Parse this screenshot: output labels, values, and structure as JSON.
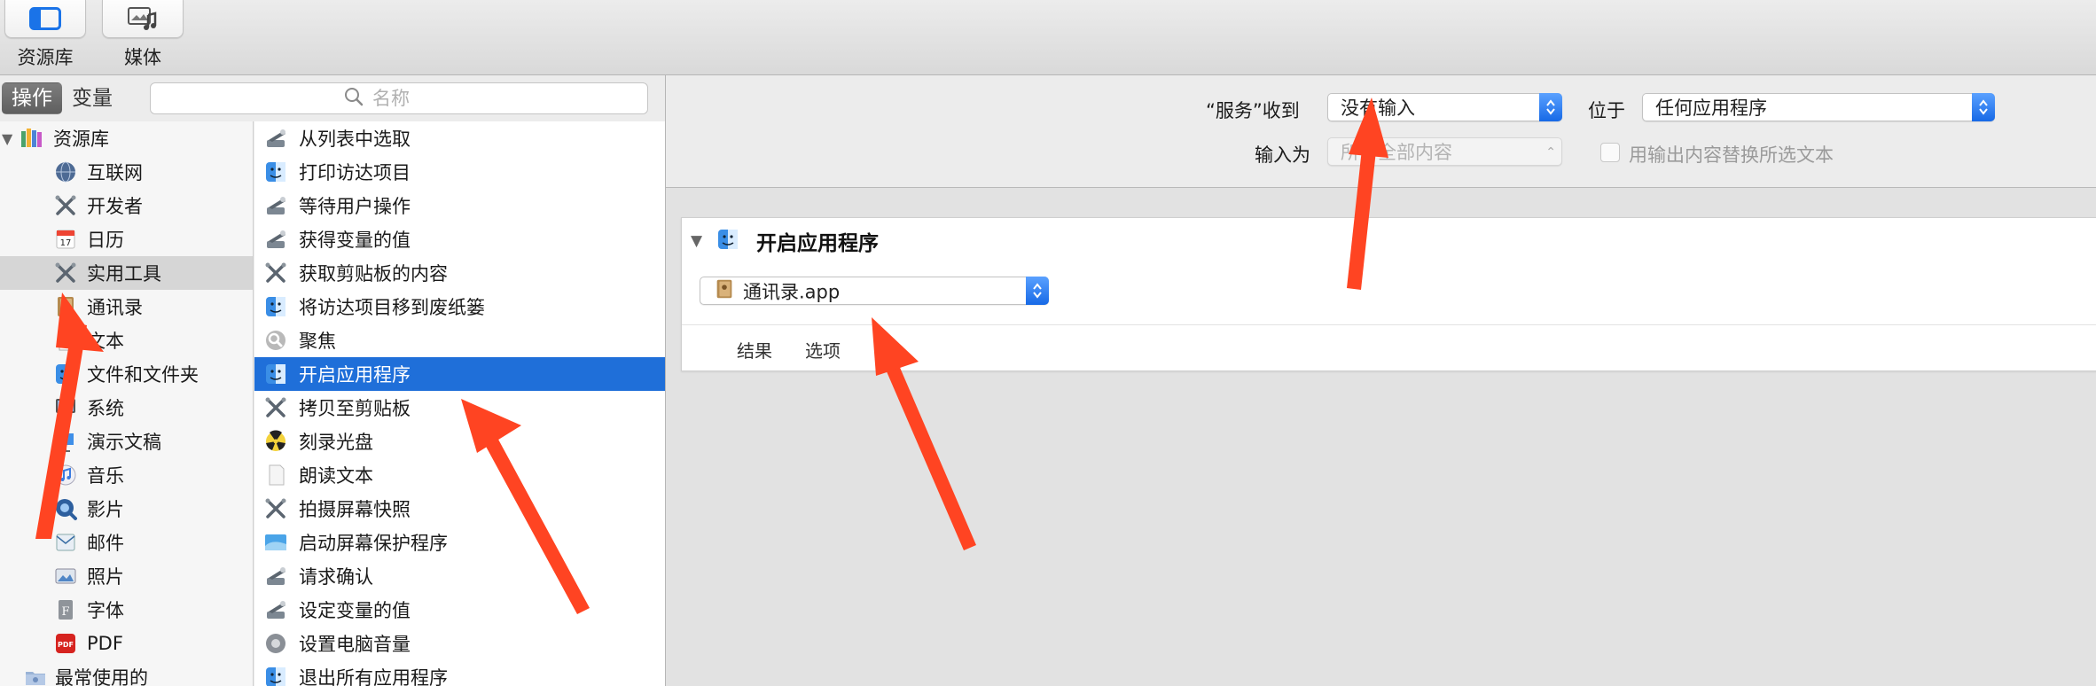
{
  "toolbar": {
    "library_label": "资源库",
    "media_label": "媒体"
  },
  "sidebar": {
    "segments": [
      {
        "label": "操作",
        "active": true
      },
      {
        "label": "变量",
        "active": false
      }
    ],
    "search_placeholder": "名称",
    "library_root": "资源库",
    "categories": [
      {
        "label": "互联网",
        "icon": "globe-icon"
      },
      {
        "label": "开发者",
        "icon": "tools-icon"
      },
      {
        "label": "日历",
        "icon": "calendar-icon"
      },
      {
        "label": "实用工具",
        "icon": "tools-icon",
        "selected": true
      },
      {
        "label": "通讯录",
        "icon": "contacts-icon"
      },
      {
        "label": "文本",
        "icon": "text-icon"
      },
      {
        "label": "文件和文件夹",
        "icon": "finder-icon"
      },
      {
        "label": "系统",
        "icon": "system-icon"
      },
      {
        "label": "演示文稿",
        "icon": "keynote-icon"
      },
      {
        "label": "音乐",
        "icon": "music-icon"
      },
      {
        "label": "影片",
        "icon": "quicktime-icon"
      },
      {
        "label": "邮件",
        "icon": "mail-icon"
      },
      {
        "label": "照片",
        "icon": "photos-icon"
      },
      {
        "label": "字体",
        "icon": "font-icon"
      },
      {
        "label": "PDF",
        "icon": "pdf-icon"
      }
    ],
    "recent": "最常使用的"
  },
  "actions": [
    {
      "label": "从列表中选取",
      "icon": "automator-icon"
    },
    {
      "label": "打印访达项目",
      "icon": "finder-icon"
    },
    {
      "label": "等待用户操作",
      "icon": "automator-icon"
    },
    {
      "label": "获得变量的值",
      "icon": "automator-icon"
    },
    {
      "label": "获取剪贴板的内容",
      "icon": "tools-icon"
    },
    {
      "label": "将访达项目移到废纸篓",
      "icon": "finder-icon"
    },
    {
      "label": "聚焦",
      "icon": "spotlight-icon"
    },
    {
      "label": "开启应用程序",
      "icon": "finder-icon",
      "selected": true
    },
    {
      "label": "拷贝至剪贴板",
      "icon": "tools-icon"
    },
    {
      "label": "刻录光盘",
      "icon": "burn-icon"
    },
    {
      "label": "朗读文本",
      "icon": "document-icon"
    },
    {
      "label": "拍摄屏幕快照",
      "icon": "tools-icon"
    },
    {
      "label": "启动屏幕保护程序",
      "icon": "screensaver-icon"
    },
    {
      "label": "请求确认",
      "icon": "automator-icon"
    },
    {
      "label": "设定变量的值",
      "icon": "automator-icon"
    },
    {
      "label": "设置电脑音量",
      "icon": "preferences-icon"
    },
    {
      "label": "退出所有应用程序",
      "icon": "finder-icon"
    }
  ],
  "service": {
    "receives_label": "“服务”收到",
    "receives_value": "没有输入",
    "in_label": "位于",
    "in_value": "任何应用程序",
    "input_is_label": "输入为",
    "input_is_value": "所有全部内容",
    "replace_label": "用输出内容替换所选文本"
  },
  "action_card": {
    "title": "开启应用程序",
    "app_value": "通讯录.app",
    "tabs": [
      "结果",
      "选项"
    ]
  },
  "colors": {
    "accent": "#1f6fd9",
    "annotation": "#ff4422"
  }
}
